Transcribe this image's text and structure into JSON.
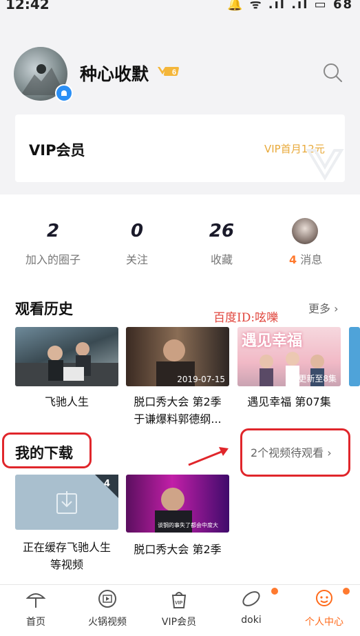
{
  "status_bar": {
    "time": "12:42",
    "icons_text": "🔔 ᯤ .ıl .ıl ▭",
    "battery": "68"
  },
  "profile": {
    "username": "种心收默",
    "level": "6"
  },
  "vip_card": {
    "title": "VIP会员",
    "promo": "VIP首月12元"
  },
  "stats": [
    {
      "value": "2",
      "label": "加入的圈子"
    },
    {
      "value": "0",
      "label": "关注"
    },
    {
      "value": "26",
      "label": "收藏"
    }
  ],
  "messages": {
    "count": "4",
    "label": "消息"
  },
  "history": {
    "title": "观看历史",
    "more": "更多",
    "watermark": "百度ID:呟嚛",
    "items": [
      {
        "title_line1": "飞驰人生",
        "title_line2": "",
        "caption": ""
      },
      {
        "title_line1": "脱口秀大会 第2季",
        "title_line2": "于谦爆料郭德纲...",
        "caption": "2019-07-15"
      },
      {
        "title_line1": "遇见幸福 第07集",
        "title_line2": "",
        "caption": "更新至8集",
        "poster_text": "遇见幸福"
      }
    ]
  },
  "downloads": {
    "title": "我的下载",
    "pending": "2个视频待观看",
    "items": [
      {
        "count": "4",
        "title_line1": "正在缓存飞驰人生",
        "title_line2": "等视频"
      },
      {
        "title_line1": "脱口秀大会 第2季",
        "caption": "谈钢的事失了都会中度大"
      }
    ]
  },
  "nav": [
    {
      "label": "首页",
      "icon": "home-icon"
    },
    {
      "label": "火锅视频",
      "icon": "hotpot-video-icon"
    },
    {
      "label": "VIP会员",
      "icon": "vip-icon"
    },
    {
      "label": "doki",
      "icon": "doki-icon"
    },
    {
      "label": "个人中心",
      "icon": "profile-icon"
    }
  ],
  "colors": {
    "accent": "#ff7a2f",
    "vip_gold": "#e8a93a",
    "annotation_red": "#e0262b"
  }
}
